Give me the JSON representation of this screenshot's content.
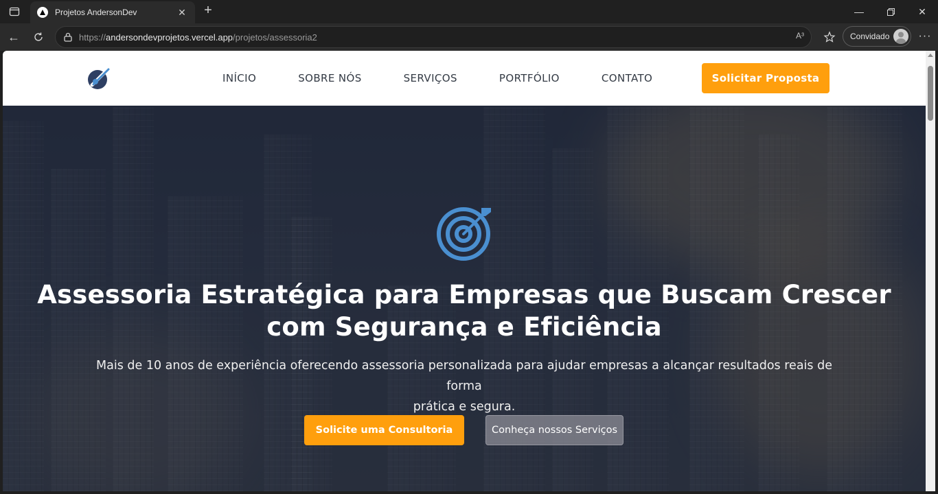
{
  "browser": {
    "tab_title": "Projetos AndersonDev",
    "url_scheme": "https://",
    "url_host": "andersondevprojetos.vercel.app",
    "url_path": "/projetos/assessoria2",
    "read_aloud": "A³",
    "profile_label": "Convidado"
  },
  "site": {
    "nav": [
      "INÍCIO",
      "SOBRE NÓS",
      "SERVIÇOS",
      "PORTFÓLIO",
      "CONTATO"
    ],
    "header_cta": "Solicitar Proposta",
    "hero": {
      "title_line1": "Assessoria Estratégica para Empresas que Buscam Crescer",
      "title_line2": "com Segurança e Eficiência",
      "subtitle_line1": "Mais de 10 anos de experiência oferecendo assessoria personalizada para ajudar empresas a alcançar resultados reais de forma",
      "subtitle_line2": "prática e segura.",
      "primary_button": "Solicite uma Consultoria",
      "secondary_button": "Conheça nossos Serviços"
    }
  },
  "colors": {
    "accent": "#ff9f0d",
    "icon_blue": "#4a8fd0",
    "hero_overlay": "#1a2132"
  }
}
